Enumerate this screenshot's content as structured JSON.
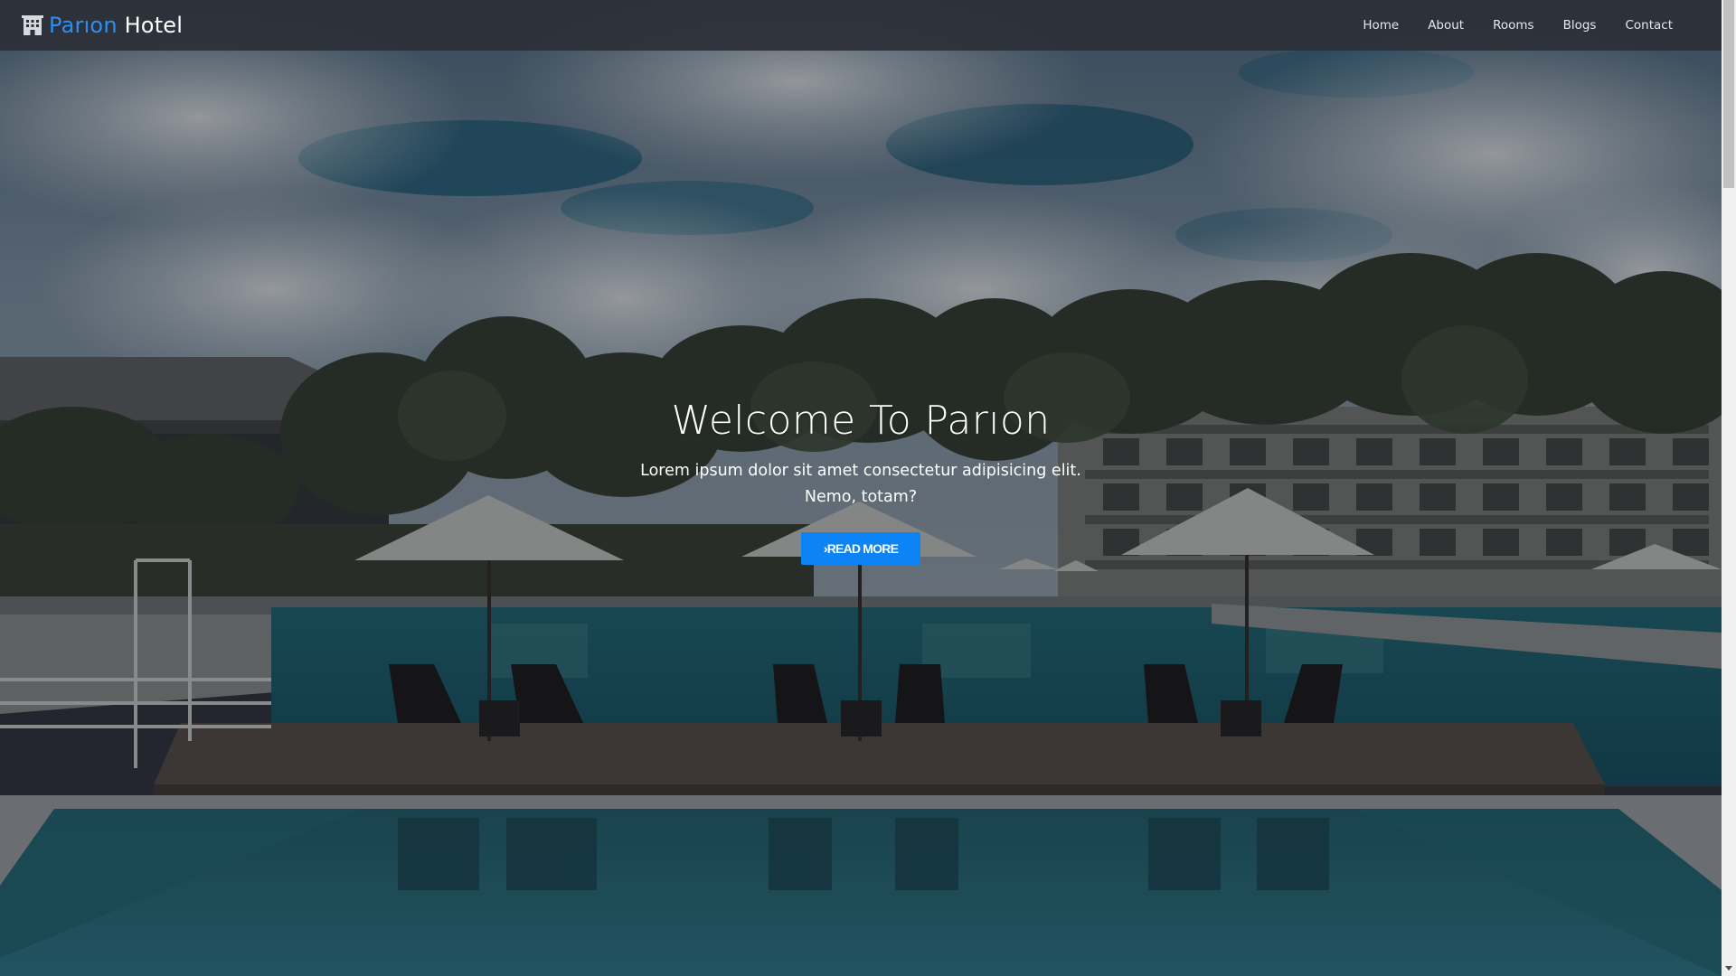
{
  "brand": {
    "accent": "Parıon",
    "rest": " Hotel",
    "icon": "hotel-building-icon",
    "accent_color": "#2f8ff0"
  },
  "nav": {
    "items": [
      {
        "label": "Home"
      },
      {
        "label": "About"
      },
      {
        "label": "Rooms"
      },
      {
        "label": "Blogs"
      },
      {
        "label": "Contact"
      }
    ]
  },
  "hero": {
    "title": "Welcome To Parıon",
    "subtitle": "Lorem ipsum dolor sit amet consectetur adipisicing elit. Nemo, totam?",
    "button_label": "READ MORE",
    "button_icon": "chevron-right-icon",
    "button_color": "#0d84f5",
    "background_image": "hotel-pool-photo"
  },
  "scrollbar": {
    "up_icon": "scroll-up-arrow-icon",
    "down_icon": "scroll-down-arrow-icon"
  }
}
